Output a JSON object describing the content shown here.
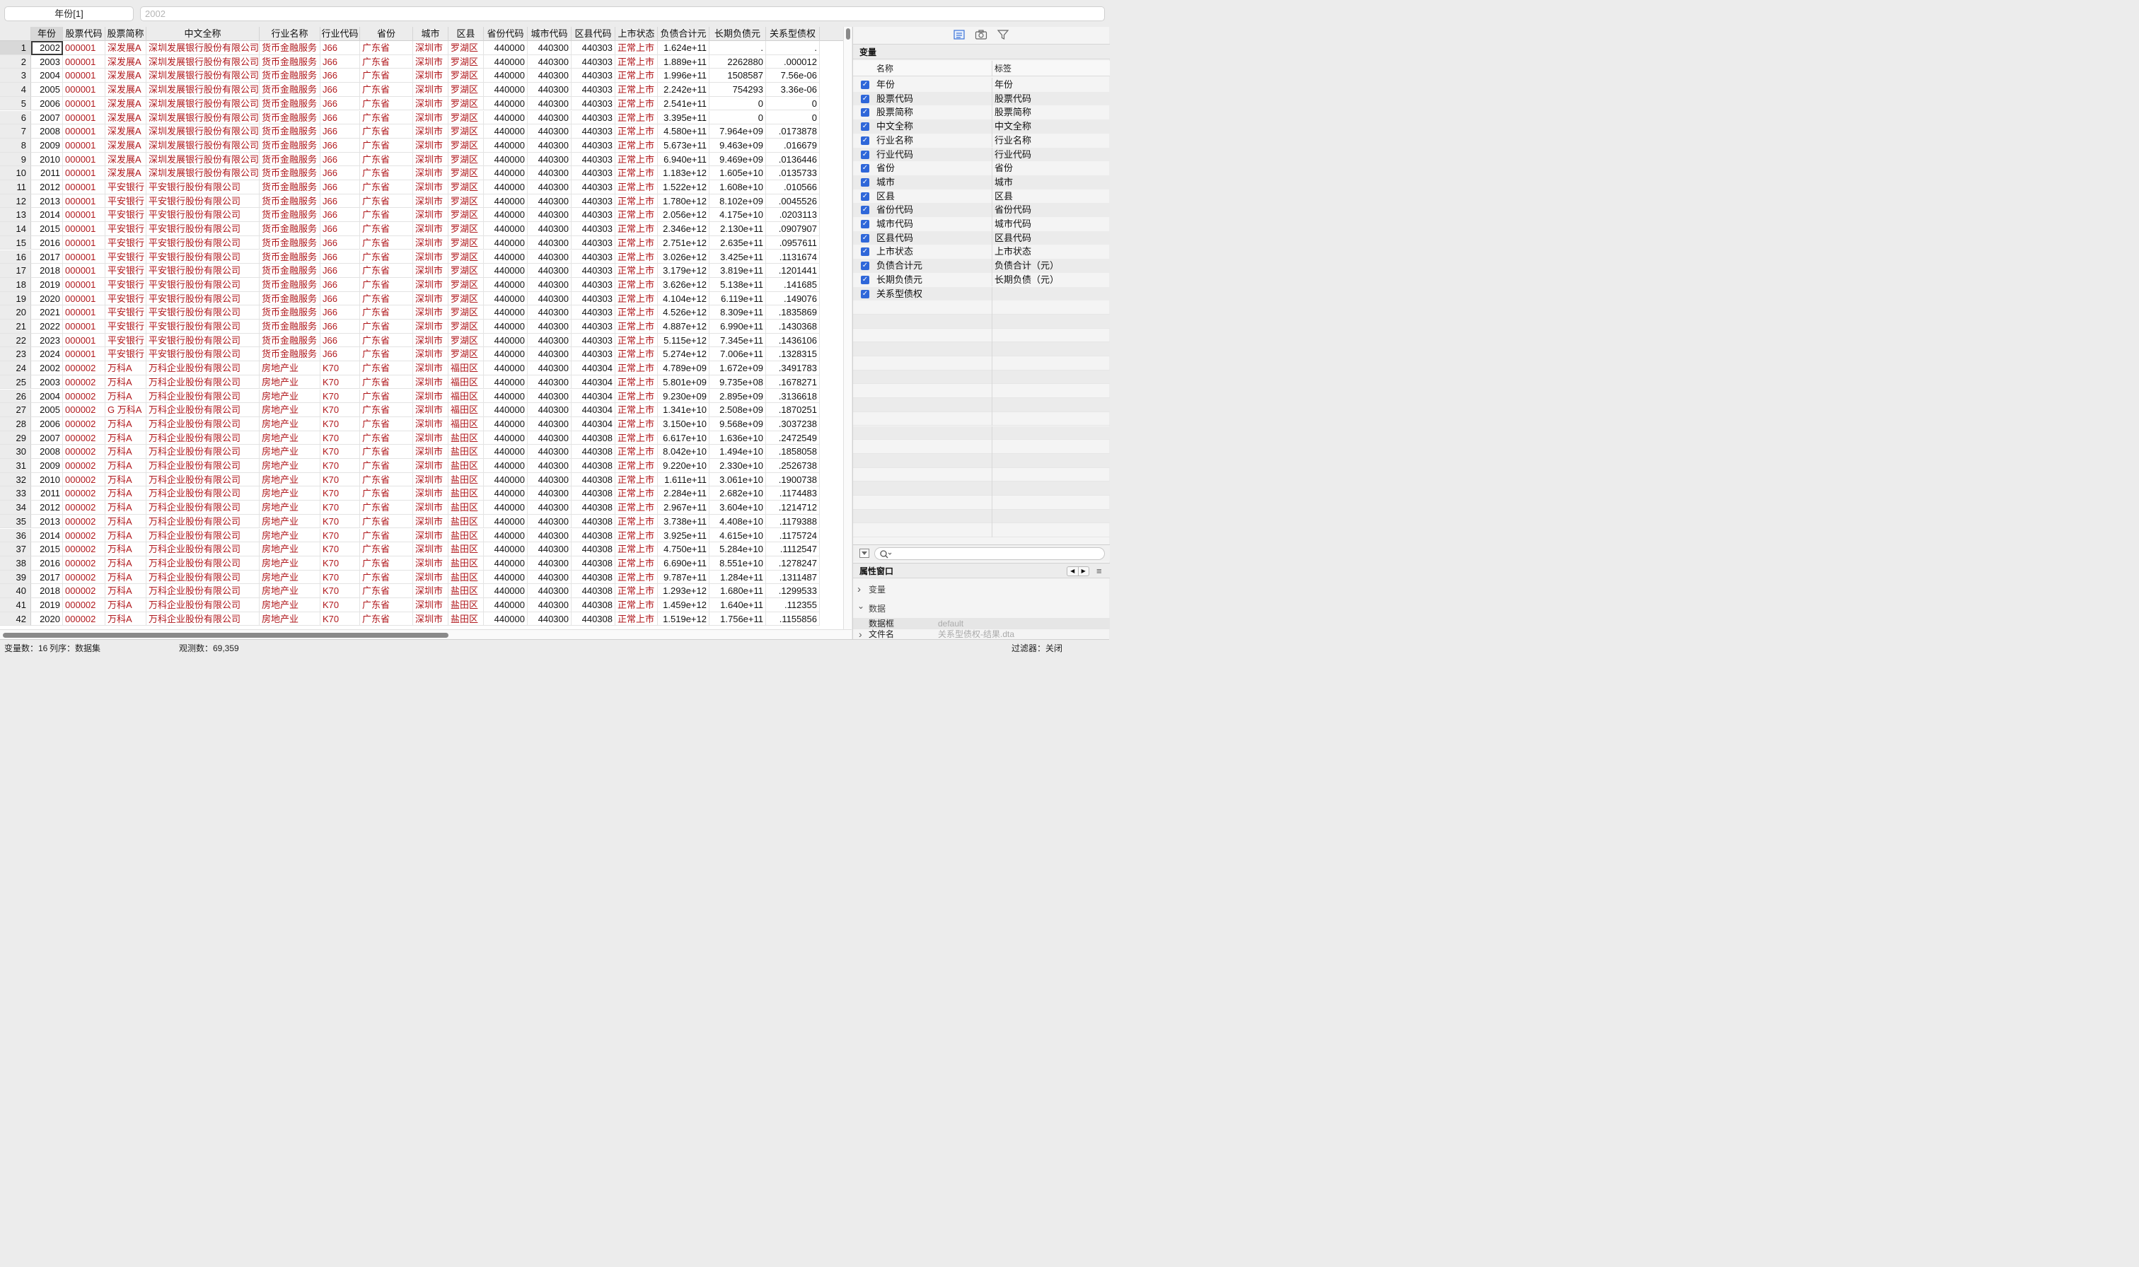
{
  "editbar": {
    "cell_ref": "年份[1]",
    "cell_value": "2002"
  },
  "columns": [
    "年份",
    "股票代码",
    "股票简称",
    "中文全称",
    "行业名称",
    "行业代码",
    "省份",
    "城市",
    "区县",
    "省份代码",
    "城市代码",
    "区县代码",
    "上市状态",
    "负债合计元",
    "长期负债元",
    "关系型债权"
  ],
  "rows": [
    [
      "2002",
      "000001",
      "深发展A",
      "深圳发展银行股份有限公司",
      "货币金融服务",
      "J66",
      "广东省",
      "深圳市",
      "罗湖区",
      "440000",
      "440300",
      "440303",
      "正常上市",
      "1.624e+11",
      ".",
      "."
    ],
    [
      "2003",
      "000001",
      "深发展A",
      "深圳发展银行股份有限公司",
      "货币金融服务",
      "J66",
      "广东省",
      "深圳市",
      "罗湖区",
      "440000",
      "440300",
      "440303",
      "正常上市",
      "1.889e+11",
      "2262880",
      ".000012"
    ],
    [
      "2004",
      "000001",
      "深发展A",
      "深圳发展银行股份有限公司",
      "货币金融服务",
      "J66",
      "广东省",
      "深圳市",
      "罗湖区",
      "440000",
      "440300",
      "440303",
      "正常上市",
      "1.996e+11",
      "1508587",
      "7.56e-06"
    ],
    [
      "2005",
      "000001",
      "深发展A",
      "深圳发展银行股份有限公司",
      "货币金融服务",
      "J66",
      "广东省",
      "深圳市",
      "罗湖区",
      "440000",
      "440300",
      "440303",
      "正常上市",
      "2.242e+11",
      "754293",
      "3.36e-06"
    ],
    [
      "2006",
      "000001",
      "深发展A",
      "深圳发展银行股份有限公司",
      "货币金融服务",
      "J66",
      "广东省",
      "深圳市",
      "罗湖区",
      "440000",
      "440300",
      "440303",
      "正常上市",
      "2.541e+11",
      "0",
      "0"
    ],
    [
      "2007",
      "000001",
      "深发展A",
      "深圳发展银行股份有限公司",
      "货币金融服务",
      "J66",
      "广东省",
      "深圳市",
      "罗湖区",
      "440000",
      "440300",
      "440303",
      "正常上市",
      "3.395e+11",
      "0",
      "0"
    ],
    [
      "2008",
      "000001",
      "深发展A",
      "深圳发展银行股份有限公司",
      "货币金融服务",
      "J66",
      "广东省",
      "深圳市",
      "罗湖区",
      "440000",
      "440300",
      "440303",
      "正常上市",
      "4.580e+11",
      "7.964e+09",
      ".0173878"
    ],
    [
      "2009",
      "000001",
      "深发展A",
      "深圳发展银行股份有限公司",
      "货币金融服务",
      "J66",
      "广东省",
      "深圳市",
      "罗湖区",
      "440000",
      "440300",
      "440303",
      "正常上市",
      "5.673e+11",
      "9.463e+09",
      ".016679"
    ],
    [
      "2010",
      "000001",
      "深发展A",
      "深圳发展银行股份有限公司",
      "货币金融服务",
      "J66",
      "广东省",
      "深圳市",
      "罗湖区",
      "440000",
      "440300",
      "440303",
      "正常上市",
      "6.940e+11",
      "9.469e+09",
      ".0136446"
    ],
    [
      "2011",
      "000001",
      "深发展A",
      "深圳发展银行股份有限公司",
      "货币金融服务",
      "J66",
      "广东省",
      "深圳市",
      "罗湖区",
      "440000",
      "440300",
      "440303",
      "正常上市",
      "1.183e+12",
      "1.605e+10",
      ".0135733"
    ],
    [
      "2012",
      "000001",
      "平安银行",
      "平安银行股份有限公司",
      "货币金融服务",
      "J66",
      "广东省",
      "深圳市",
      "罗湖区",
      "440000",
      "440300",
      "440303",
      "正常上市",
      "1.522e+12",
      "1.608e+10",
      ".010566"
    ],
    [
      "2013",
      "000001",
      "平安银行",
      "平安银行股份有限公司",
      "货币金融服务",
      "J66",
      "广东省",
      "深圳市",
      "罗湖区",
      "440000",
      "440300",
      "440303",
      "正常上市",
      "1.780e+12",
      "8.102e+09",
      ".0045526"
    ],
    [
      "2014",
      "000001",
      "平安银行",
      "平安银行股份有限公司",
      "货币金融服务",
      "J66",
      "广东省",
      "深圳市",
      "罗湖区",
      "440000",
      "440300",
      "440303",
      "正常上市",
      "2.056e+12",
      "4.175e+10",
      ".0203113"
    ],
    [
      "2015",
      "000001",
      "平安银行",
      "平安银行股份有限公司",
      "货币金融服务",
      "J66",
      "广东省",
      "深圳市",
      "罗湖区",
      "440000",
      "440300",
      "440303",
      "正常上市",
      "2.346e+12",
      "2.130e+11",
      ".0907907"
    ],
    [
      "2016",
      "000001",
      "平安银行",
      "平安银行股份有限公司",
      "货币金融服务",
      "J66",
      "广东省",
      "深圳市",
      "罗湖区",
      "440000",
      "440300",
      "440303",
      "正常上市",
      "2.751e+12",
      "2.635e+11",
      ".0957611"
    ],
    [
      "2017",
      "000001",
      "平安银行",
      "平安银行股份有限公司",
      "货币金融服务",
      "J66",
      "广东省",
      "深圳市",
      "罗湖区",
      "440000",
      "440300",
      "440303",
      "正常上市",
      "3.026e+12",
      "3.425e+11",
      ".1131674"
    ],
    [
      "2018",
      "000001",
      "平安银行",
      "平安银行股份有限公司",
      "货币金融服务",
      "J66",
      "广东省",
      "深圳市",
      "罗湖区",
      "440000",
      "440300",
      "440303",
      "正常上市",
      "3.179e+12",
      "3.819e+11",
      ".1201441"
    ],
    [
      "2019",
      "000001",
      "平安银行",
      "平安银行股份有限公司",
      "货币金融服务",
      "J66",
      "广东省",
      "深圳市",
      "罗湖区",
      "440000",
      "440300",
      "440303",
      "正常上市",
      "3.626e+12",
      "5.138e+11",
      ".141685"
    ],
    [
      "2020",
      "000001",
      "平安银行",
      "平安银行股份有限公司",
      "货币金融服务",
      "J66",
      "广东省",
      "深圳市",
      "罗湖区",
      "440000",
      "440300",
      "440303",
      "正常上市",
      "4.104e+12",
      "6.119e+11",
      ".149076"
    ],
    [
      "2021",
      "000001",
      "平安银行",
      "平安银行股份有限公司",
      "货币金融服务",
      "J66",
      "广东省",
      "深圳市",
      "罗湖区",
      "440000",
      "440300",
      "440303",
      "正常上市",
      "4.526e+12",
      "8.309e+11",
      ".1835869"
    ],
    [
      "2022",
      "000001",
      "平安银行",
      "平安银行股份有限公司",
      "货币金融服务",
      "J66",
      "广东省",
      "深圳市",
      "罗湖区",
      "440000",
      "440300",
      "440303",
      "正常上市",
      "4.887e+12",
      "6.990e+11",
      ".1430368"
    ],
    [
      "2023",
      "000001",
      "平安银行",
      "平安银行股份有限公司",
      "货币金融服务",
      "J66",
      "广东省",
      "深圳市",
      "罗湖区",
      "440000",
      "440300",
      "440303",
      "正常上市",
      "5.115e+12",
      "7.345e+11",
      ".1436106"
    ],
    [
      "2024",
      "000001",
      "平安银行",
      "平安银行股份有限公司",
      "货币金融服务",
      "J66",
      "广东省",
      "深圳市",
      "罗湖区",
      "440000",
      "440300",
      "440303",
      "正常上市",
      "5.274e+12",
      "7.006e+11",
      ".1328315"
    ],
    [
      "2002",
      "000002",
      "万科A",
      "万科企业股份有限公司",
      "房地产业",
      "K70",
      "广东省",
      "深圳市",
      "福田区",
      "440000",
      "440300",
      "440304",
      "正常上市",
      "4.789e+09",
      "1.672e+09",
      ".3491783"
    ],
    [
      "2003",
      "000002",
      "万科A",
      "万科企业股份有限公司",
      "房地产业",
      "K70",
      "广东省",
      "深圳市",
      "福田区",
      "440000",
      "440300",
      "440304",
      "正常上市",
      "5.801e+09",
      "9.735e+08",
      ".1678271"
    ],
    [
      "2004",
      "000002",
      "万科A",
      "万科企业股份有限公司",
      "房地产业",
      "K70",
      "广东省",
      "深圳市",
      "福田区",
      "440000",
      "440300",
      "440304",
      "正常上市",
      "9.230e+09",
      "2.895e+09",
      ".3136618"
    ],
    [
      "2005",
      "000002",
      "G 万科A",
      "万科企业股份有限公司",
      "房地产业",
      "K70",
      "广东省",
      "深圳市",
      "福田区",
      "440000",
      "440300",
      "440304",
      "正常上市",
      "1.341e+10",
      "2.508e+09",
      ".1870251"
    ],
    [
      "2006",
      "000002",
      "万科A",
      "万科企业股份有限公司",
      "房地产业",
      "K70",
      "广东省",
      "深圳市",
      "福田区",
      "440000",
      "440300",
      "440304",
      "正常上市",
      "3.150e+10",
      "9.568e+09",
      ".3037238"
    ],
    [
      "2007",
      "000002",
      "万科A",
      "万科企业股份有限公司",
      "房地产业",
      "K70",
      "广东省",
      "深圳市",
      "盐田区",
      "440000",
      "440300",
      "440308",
      "正常上市",
      "6.617e+10",
      "1.636e+10",
      ".2472549"
    ],
    [
      "2008",
      "000002",
      "万科A",
      "万科企业股份有限公司",
      "房地产业",
      "K70",
      "广东省",
      "深圳市",
      "盐田区",
      "440000",
      "440300",
      "440308",
      "正常上市",
      "8.042e+10",
      "1.494e+10",
      ".1858058"
    ],
    [
      "2009",
      "000002",
      "万科A",
      "万科企业股份有限公司",
      "房地产业",
      "K70",
      "广东省",
      "深圳市",
      "盐田区",
      "440000",
      "440300",
      "440308",
      "正常上市",
      "9.220e+10",
      "2.330e+10",
      ".2526738"
    ],
    [
      "2010",
      "000002",
      "万科A",
      "万科企业股份有限公司",
      "房地产业",
      "K70",
      "广东省",
      "深圳市",
      "盐田区",
      "440000",
      "440300",
      "440308",
      "正常上市",
      "1.611e+11",
      "3.061e+10",
      ".1900738"
    ],
    [
      "2011",
      "000002",
      "万科A",
      "万科企业股份有限公司",
      "房地产业",
      "K70",
      "广东省",
      "深圳市",
      "盐田区",
      "440000",
      "440300",
      "440308",
      "正常上市",
      "2.284e+11",
      "2.682e+10",
      ".1174483"
    ],
    [
      "2012",
      "000002",
      "万科A",
      "万科企业股份有限公司",
      "房地产业",
      "K70",
      "广东省",
      "深圳市",
      "盐田区",
      "440000",
      "440300",
      "440308",
      "正常上市",
      "2.967e+11",
      "3.604e+10",
      ".1214712"
    ],
    [
      "2013",
      "000002",
      "万科A",
      "万科企业股份有限公司",
      "房地产业",
      "K70",
      "广东省",
      "深圳市",
      "盐田区",
      "440000",
      "440300",
      "440308",
      "正常上市",
      "3.738e+11",
      "4.408e+10",
      ".1179388"
    ],
    [
      "2014",
      "000002",
      "万科A",
      "万科企业股份有限公司",
      "房地产业",
      "K70",
      "广东省",
      "深圳市",
      "盐田区",
      "440000",
      "440300",
      "440308",
      "正常上市",
      "3.925e+11",
      "4.615e+10",
      ".1175724"
    ],
    [
      "2015",
      "000002",
      "万科A",
      "万科企业股份有限公司",
      "房地产业",
      "K70",
      "广东省",
      "深圳市",
      "盐田区",
      "440000",
      "440300",
      "440308",
      "正常上市",
      "4.750e+11",
      "5.284e+10",
      ".1112547"
    ],
    [
      "2016",
      "000002",
      "万科A",
      "万科企业股份有限公司",
      "房地产业",
      "K70",
      "广东省",
      "深圳市",
      "盐田区",
      "440000",
      "440300",
      "440308",
      "正常上市",
      "6.690e+11",
      "8.551e+10",
      ".1278247"
    ],
    [
      "2017",
      "000002",
      "万科A",
      "万科企业股份有限公司",
      "房地产业",
      "K70",
      "广东省",
      "深圳市",
      "盐田区",
      "440000",
      "440300",
      "440308",
      "正常上市",
      "9.787e+11",
      "1.284e+11",
      ".1311487"
    ],
    [
      "2018",
      "000002",
      "万科A",
      "万科企业股份有限公司",
      "房地产业",
      "K70",
      "广东省",
      "深圳市",
      "盐田区",
      "440000",
      "440300",
      "440308",
      "正常上市",
      "1.293e+12",
      "1.680e+11",
      ".1299533"
    ],
    [
      "2019",
      "000002",
      "万科A",
      "万科企业股份有限公司",
      "房地产业",
      "K70",
      "广东省",
      "深圳市",
      "盐田区",
      "440000",
      "440300",
      "440308",
      "正常上市",
      "1.459e+12",
      "1.640e+11",
      ".112355"
    ],
    [
      "2020",
      "000002",
      "万科A",
      "万科企业股份有限公司",
      "房地产业",
      "K70",
      "广东省",
      "深圳市",
      "盐田区",
      "440000",
      "440300",
      "440308",
      "正常上市",
      "1.519e+12",
      "1.756e+11",
      ".1155856"
    ]
  ],
  "variables_panel": {
    "title": "变量",
    "col_name": "名称",
    "col_label": "标签",
    "items": [
      {
        "name": "年份",
        "label": "年份"
      },
      {
        "name": "股票代码",
        "label": "股票代码"
      },
      {
        "name": "股票简称",
        "label": "股票简称"
      },
      {
        "name": "中文全称",
        "label": "中文全称"
      },
      {
        "name": "行业名称",
        "label": "行业名称"
      },
      {
        "name": "行业代码",
        "label": "行业代码"
      },
      {
        "name": "省份",
        "label": "省份"
      },
      {
        "name": "城市",
        "label": "城市"
      },
      {
        "name": "区县",
        "label": "区县"
      },
      {
        "name": "省份代码",
        "label": "省份代码"
      },
      {
        "name": "城市代码",
        "label": "城市代码"
      },
      {
        "name": "区县代码",
        "label": "区县代码"
      },
      {
        "name": "上市状态",
        "label": "上市状态"
      },
      {
        "name": "负债合计元",
        "label": "负债合计（元）"
      },
      {
        "name": "长期负债元",
        "label": "长期负债（元）"
      },
      {
        "name": "关系型债权",
        "label": ""
      }
    ],
    "check_glyph": "✓"
  },
  "properties_panel": {
    "title": "属性窗口",
    "nav_prev": "◀",
    "nav_next": "▶",
    "menu_glyph": "≡",
    "section_variables": "变量",
    "section_data": "数据",
    "frame_label": "数据框",
    "frame_value": "default",
    "filename_label": "文件名",
    "filename_value": "关系型债权-结果.dta",
    "chev_collapsed": "›",
    "chev_expanded": "⌄"
  },
  "statusbar": {
    "vars": "变量数：16",
    "order": "列序：数据集",
    "obs": "观测数：69,359",
    "filter": "过滤器：关闭"
  },
  "colors": {
    "string_text": "#b0181c",
    "checkbox": "#2f67d9"
  }
}
